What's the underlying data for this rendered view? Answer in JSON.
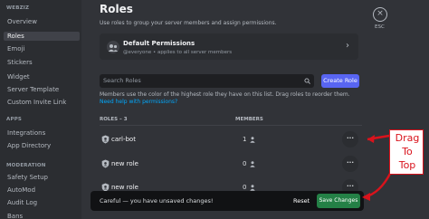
{
  "sidebar": {
    "server_header": "WEBZIZ",
    "items": [
      "Overview",
      "Roles",
      "Emoji",
      "Stickers",
      "Widget",
      "Server Template",
      "Custom Invite Link"
    ],
    "apps_header": "APPS",
    "apps_items": [
      "Integrations",
      "App Directory"
    ],
    "moderation_header": "MODERATION",
    "moderation_items": [
      "Safety Setup",
      "AutoMod",
      "Audit Log",
      "Bans"
    ]
  },
  "page": {
    "title": "Roles",
    "subtitle": "Use roles to group your server members and assign permissions."
  },
  "default_permissions": {
    "title": "Default Permissions",
    "subtitle": "@everyone • applies to all server members"
  },
  "search": {
    "placeholder": "Search Roles"
  },
  "create_role_label": "Create Role",
  "hint": {
    "text": "Members use the color of the highest role they have on this list. Drag roles to reorder them. ",
    "link": "Need help with permissions?"
  },
  "columns": {
    "roles": "ROLES – 3",
    "members": "MEMBERS"
  },
  "roles": [
    {
      "name": "carl-bot",
      "members": "1"
    },
    {
      "name": "new role",
      "members": "0"
    },
    {
      "name": "new role",
      "members": "0"
    }
  ],
  "unsaved": {
    "message": "Careful — you have unsaved changes!",
    "reset_label": "Reset",
    "save_label": "Save Changes"
  },
  "close": {
    "icon": "×",
    "label": "ESC"
  },
  "annotation": {
    "lines": [
      "Drag",
      "To",
      "Top"
    ]
  },
  "colors": {
    "accent": "#5865f2",
    "save": "#248046",
    "link": "#00a8fc",
    "annotation": "#d9131c"
  }
}
